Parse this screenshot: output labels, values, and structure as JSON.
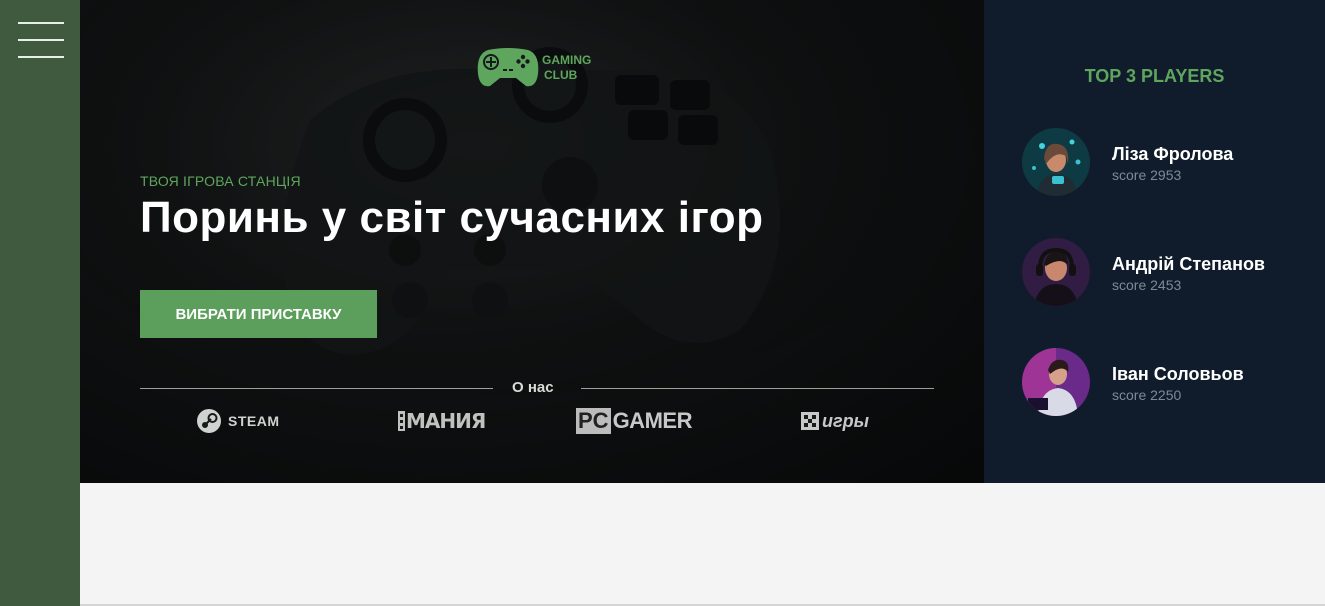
{
  "sidebar": {
    "menu_icon": "hamburger-menu-icon"
  },
  "hero": {
    "logo_text_line1": "GAMING",
    "logo_text_line2": "CLUB",
    "subtitle": "ТВОЯ ІГРОВА СТАНЦІЯ",
    "headline": "Поринь у світ сучасних ігор",
    "cta_label": "ВИБРАТИ ПРИСТАВКУ",
    "about_label": "О нас",
    "partners": [
      {
        "name": "STEAM",
        "icon": "steam-logo-icon"
      },
      {
        "name": "МАНИЯ",
        "icon": "igromania-logo"
      },
      {
        "name_pc": "PC",
        "name_rest": "GAMER",
        "icon": "pcgamer-logo"
      },
      {
        "name": "игры",
        "icon": "igry-logo"
      }
    ]
  },
  "players": {
    "title": "TOP 3 PLAYERS",
    "list": [
      {
        "name": "Ліза Фролова",
        "score": "score 2953"
      },
      {
        "name": "Андрій Степанов",
        "score": "score 2453"
      },
      {
        "name": "Іван Соловьов",
        "score": "score 2250"
      }
    ]
  },
  "colors": {
    "accent": "#5ea65e",
    "sidebar": "#3f5a3f",
    "players_bg": "#101c2b"
  }
}
